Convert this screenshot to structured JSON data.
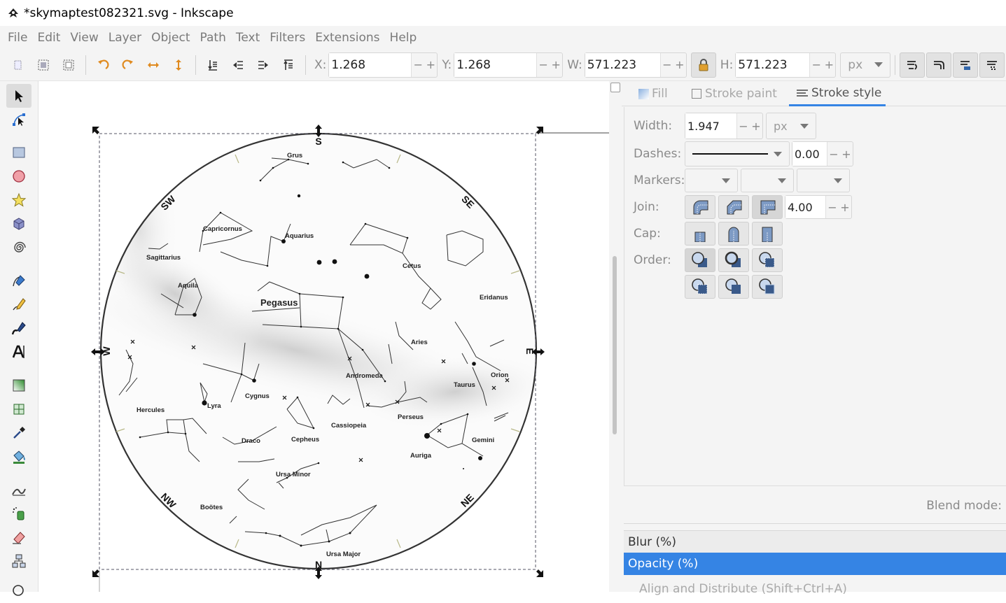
{
  "window": {
    "title": "*skymaptest082321.svg - Inkscape"
  },
  "menu": [
    "File",
    "Edit",
    "View",
    "Layer",
    "Object",
    "Path",
    "Text",
    "Filters",
    "Extensions",
    "Help"
  ],
  "toolbar": {
    "x_label": "X:",
    "x_value": "1.268",
    "y_label": "Y:",
    "y_value": "1.268",
    "w_label": "W:",
    "w_value": "571.223",
    "h_label": "H:",
    "h_value": "571.223",
    "unit": "px",
    "minus": "−",
    "plus": "+"
  },
  "panel": {
    "tabs": [
      "Fill",
      "Stroke paint",
      "Stroke style"
    ],
    "width_label": "Width:",
    "width_value": "1.947",
    "width_unit": "px",
    "dashes_label": "Dashes:",
    "dashes_offset": "0.00",
    "markers_label": "Markers:",
    "join_label": "Join:",
    "miter_value": "4.00",
    "cap_label": "Cap:",
    "order_label": "Order:",
    "blend_label": "Blend mode:",
    "blur_label": "Blur (%)",
    "opacity_label": "Opacity (%)",
    "align_label": "Align and Distribute (Shift+Ctrl+A)"
  },
  "skymap": {
    "directions": [
      "S",
      "SE",
      "E",
      "NE",
      "N",
      "NW",
      "W",
      "SW"
    ],
    "constellations": [
      "Grus",
      "Capricornus",
      "Aquarius",
      "Sagittarius",
      "Cetus",
      "Aquila",
      "Pegasus",
      "Eridanus",
      "Aries",
      "Andromeda",
      "Orion",
      "Taurus",
      "Cygnus",
      "Lyra",
      "Hercules",
      "Perseus",
      "Cassiopeia",
      "Draco",
      "Cepheus",
      "Gemini",
      "Auriga",
      "Ursa Minor",
      "Boötes",
      "Ursa Major"
    ]
  },
  "colors": {
    "accent": "#3584e4",
    "toolbar_bg": "#f4f4f4",
    "tab_underline": "#3584e4"
  }
}
